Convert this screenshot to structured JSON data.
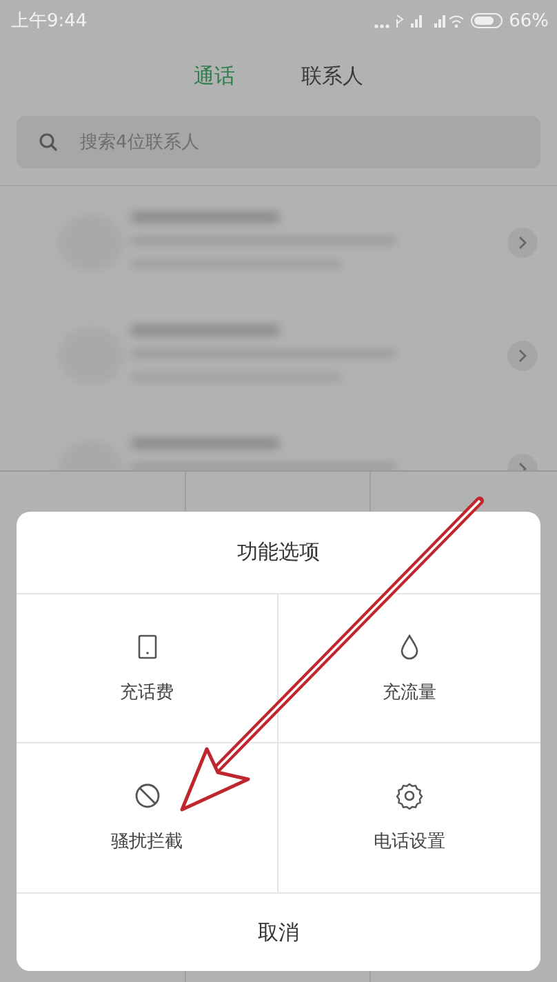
{
  "status_bar": {
    "time": "上午9:44",
    "battery": "66%"
  },
  "tabs": [
    {
      "label": "通话",
      "selected": true
    },
    {
      "label": "联系人",
      "selected": false
    }
  ],
  "search": {
    "placeholder": "搜索4位联系人"
  },
  "contacts": [
    {
      "kind": "blurred"
    },
    {
      "kind": "blurred"
    },
    {
      "kind": "blurred"
    }
  ],
  "sheet": {
    "title": "功能选项",
    "options": [
      {
        "label": "充话费",
        "kind": "tablet"
      },
      {
        "label": "充流量",
        "kind": "drop"
      },
      {
        "label": "骚扰拦截",
        "kind": "block"
      },
      {
        "label": "电话设置",
        "kind": "gear"
      }
    ],
    "cancel": "取消"
  },
  "annotation": {
    "kind": "arrow"
  }
}
